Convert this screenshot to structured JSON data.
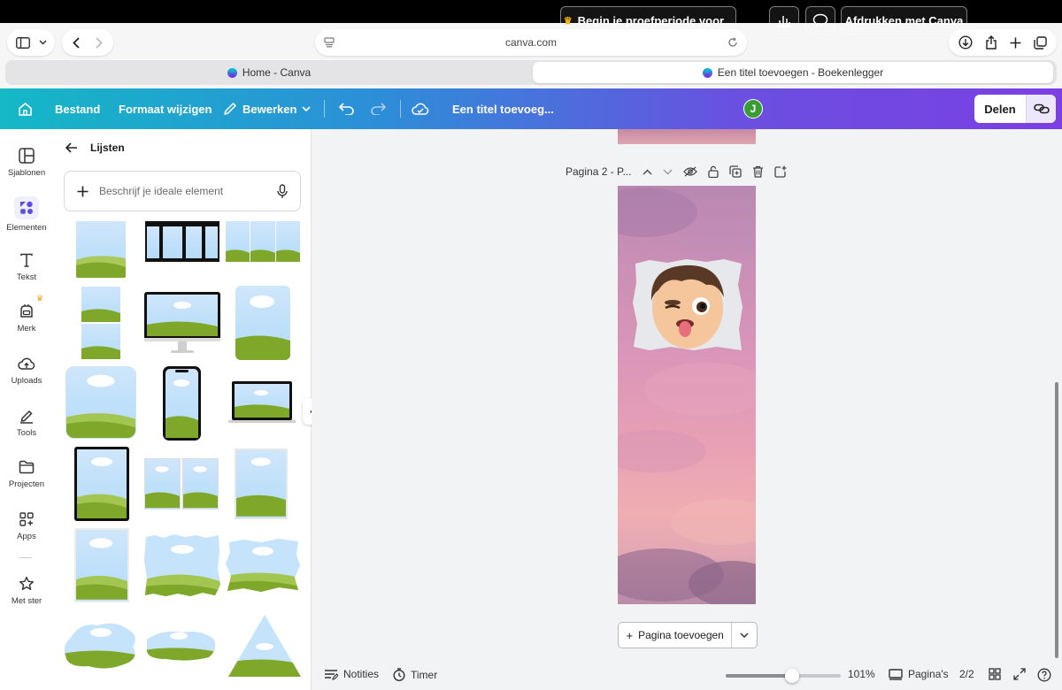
{
  "browser": {
    "url": "canva.com",
    "tabs": [
      {
        "label": "Home - Canva",
        "active": false
      },
      {
        "label": "Een titel toevoegen - Boekenlegger",
        "active": true
      }
    ]
  },
  "toolbar": {
    "file": "Bestand",
    "resize": "Formaat wijzigen",
    "edit": "Bewerken",
    "title": "Een titel toevoeg...",
    "trial": "Begin je proefperiode voor...",
    "avatar_initial": "J",
    "print": "Afdrukken met Canva",
    "share": "Delen"
  },
  "rail": {
    "items": [
      {
        "label": "Sjablonen",
        "icon": "templates-icon"
      },
      {
        "label": "Elementen",
        "icon": "elements-icon"
      },
      {
        "label": "Tekst",
        "icon": "text-icon"
      },
      {
        "label": "Merk",
        "icon": "brand-icon"
      },
      {
        "label": "Uploads",
        "icon": "upload-cloud-icon"
      },
      {
        "label": "Tools",
        "icon": "pen-tool-icon"
      },
      {
        "label": "Projecten",
        "icon": "folder-icon"
      },
      {
        "label": "Apps",
        "icon": "apps-grid-icon"
      },
      {
        "label": "Met ster",
        "icon": "star-icon"
      }
    ]
  },
  "panel": {
    "title": "Lijsten",
    "search_placeholder": "Beschrijf je ideale element"
  },
  "canvas": {
    "page_label": "Pagina 2 - P...",
    "add_page": "Pagina toevoegen"
  },
  "bottom": {
    "notes": "Notities",
    "timer": "Timer",
    "zoom": "101%",
    "zoom_slider_fraction": 0.58,
    "pages": "Pagina's",
    "page_count": "2/2"
  },
  "colors": {
    "accent_purple": "#7d2ae8",
    "toolbar_start": "#14b8c6",
    "toolbar_end": "#7b3fe4",
    "grass": "#7fae2e",
    "sky": "#c5e3fa"
  }
}
